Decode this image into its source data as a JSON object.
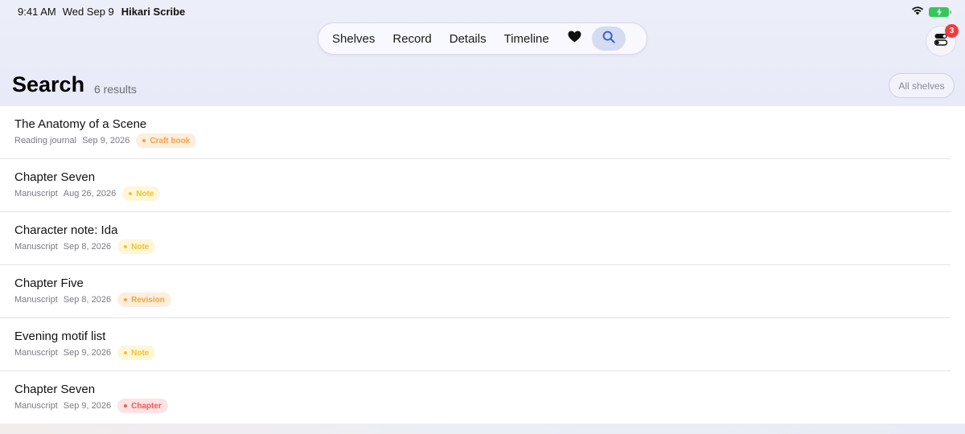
{
  "status": {
    "time": "9:41 AM",
    "date": "Wed Sep 9",
    "app_name": "Hikari Scribe",
    "wifi_icon": "wifi-icon",
    "battery_icon": "battery-charging-icon"
  },
  "nav": {
    "tabs": [
      {
        "label": "Shelves"
      },
      {
        "label": "Record"
      },
      {
        "label": "Details"
      },
      {
        "label": "Timeline"
      }
    ],
    "favorites_icon": "heart-icon",
    "search_icon": "search-icon",
    "active": "search"
  },
  "controls": {
    "toggle_icon": "toggles-icon",
    "badge_count": "3"
  },
  "page": {
    "title": "Search",
    "result_count": "6 results",
    "filter_label": "All shelves"
  },
  "results": [
    {
      "title": "The Anatomy of a Scene",
      "shelf": "Reading journal",
      "date": "Sep 9, 2026",
      "tag": "Craft book",
      "tag_color": "#f5a04a",
      "tag_bg": "#fdeedd"
    },
    {
      "title": "Chapter Seven",
      "shelf": "Manuscript",
      "date": "Aug 26, 2026",
      "tag": "Note",
      "tag_color": "#f2c230",
      "tag_bg": "#fdf6d8"
    },
    {
      "title": "Character note: Ida",
      "shelf": "Manuscript",
      "date": "Sep 8, 2026",
      "tag": "Note",
      "tag_color": "#f2c230",
      "tag_bg": "#fdf6d8"
    },
    {
      "title": "Chapter Five",
      "shelf": "Manuscript",
      "date": "Sep 8, 2026",
      "tag": "Revision",
      "tag_color": "#f2a33e",
      "tag_bg": "#fdeedd"
    },
    {
      "title": "Evening motif list",
      "shelf": "Manuscript",
      "date": "Sep 9, 2026",
      "tag": "Note",
      "tag_color": "#f2c230",
      "tag_bg": "#fdf6d8"
    },
    {
      "title": "Chapter Seven",
      "shelf": "Manuscript",
      "date": "Sep 9, 2026",
      "tag": "Chapter",
      "tag_color": "#ee5a5a",
      "tag_bg": "#fde3e3"
    }
  ]
}
